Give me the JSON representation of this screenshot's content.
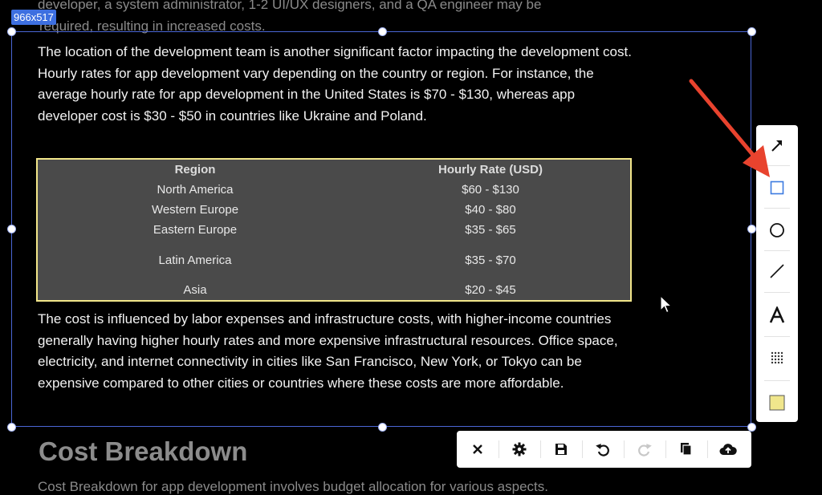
{
  "background_text": {
    "top_line_1": "developer, a system administrator, 1-2 UI/UX designers, and a QA engineer may be",
    "top_line_2": "required, resulting in increased costs.",
    "heading": "Cost Breakdown",
    "bottom_line": "Cost Breakdown for app development involves budget allocation for various aspects."
  },
  "selection": {
    "size_label": "966x517"
  },
  "content": {
    "paragraph_1": "The location of the development team is another significant factor impacting the development cost. Hourly rates for app development vary depending on the country or region. For instance, the average hourly rate for app development in the United States is $70 - $130, whereas app developer cost is $30 - $50 in countries like Ukraine and Poland.",
    "table": {
      "headers": [
        "Region",
        "Hourly Rate (USD)"
      ],
      "rows": [
        [
          "North America",
          "$60 - $130"
        ],
        [
          "Western Europe",
          "$40 - $80"
        ],
        [
          "Eastern Europe",
          "$35 - $65"
        ],
        [
          "Latin America",
          "$35 - $70"
        ],
        [
          "Asia",
          "$20 - $45"
        ]
      ]
    },
    "paragraph_2": "The cost is influenced by labor expenses and infrastructure costs, with higher-income countries generally having higher hourly rates and more expensive infrastructural resources. Office space, electricity, and internet connectivity in cities like San Francisco, New York, or Tokyo can be expensive compared to other cities or countries where these costs are more affordable."
  },
  "tools": [
    "arrow-tool",
    "rectangle-tool",
    "circle-tool",
    "line-tool",
    "text-tool",
    "blur-tool",
    "color-swatch"
  ],
  "actions": [
    "close",
    "settings",
    "save",
    "undo",
    "redo",
    "copy",
    "upload"
  ],
  "colors": {
    "selection": "#4a66d6",
    "highlight_border": "#f2e68a",
    "swatch": "#f0e68c",
    "annotation_arrow": "#e8432e"
  }
}
